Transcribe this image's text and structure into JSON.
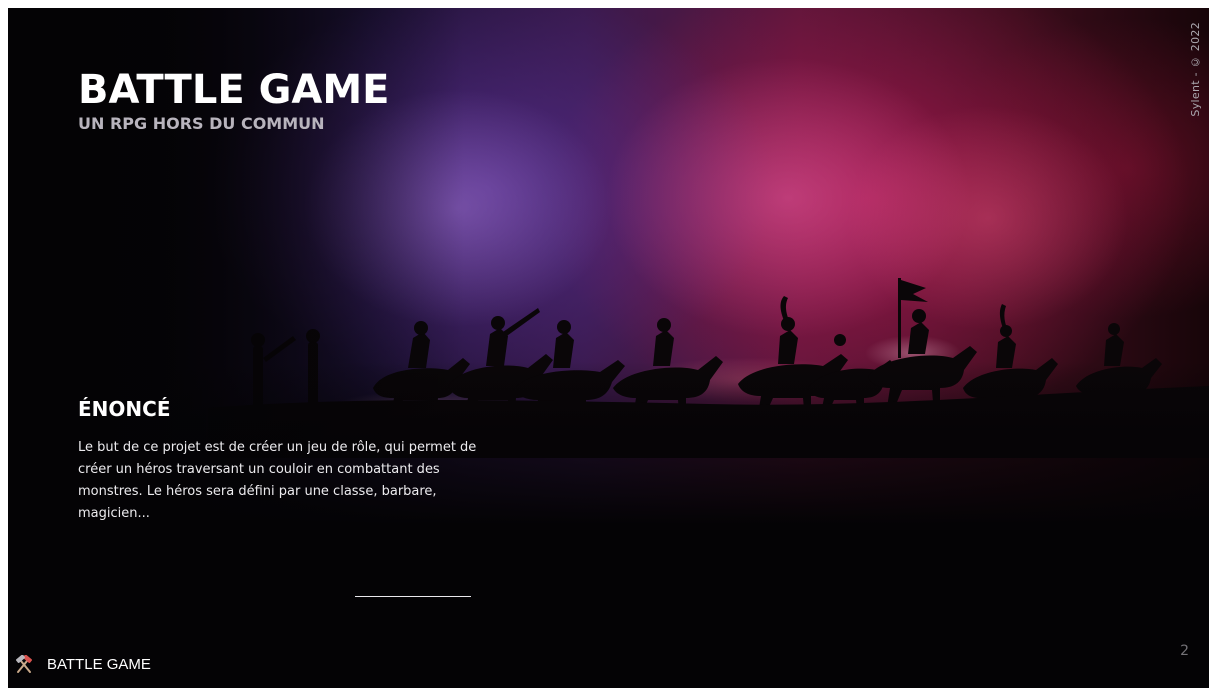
{
  "slide": {
    "title": "BATTLE GAME",
    "subtitle": "UN RPG HORS DU COMMUN",
    "credit": "Sylent - © 2022",
    "section": {
      "heading": "ÉNONCÉ",
      "body": "Le but de ce projet est de créer un jeu de rôle, qui permet de créer un héros traversant un couloir en combattant des monstres. Le héros sera défini par une classe, barbare, magicien..."
    },
    "footer": {
      "icon": "crossed-hammers-icon",
      "label": "BATTLE GAME",
      "page_number": "2"
    }
  },
  "colors": {
    "background": "#040305",
    "title_text": "#ffffff",
    "subtitle_text": "#b8b4bd",
    "smoke_purple": "#3a1a4f",
    "smoke_crimson": "#5a1538",
    "page_number_text": "#747277"
  }
}
